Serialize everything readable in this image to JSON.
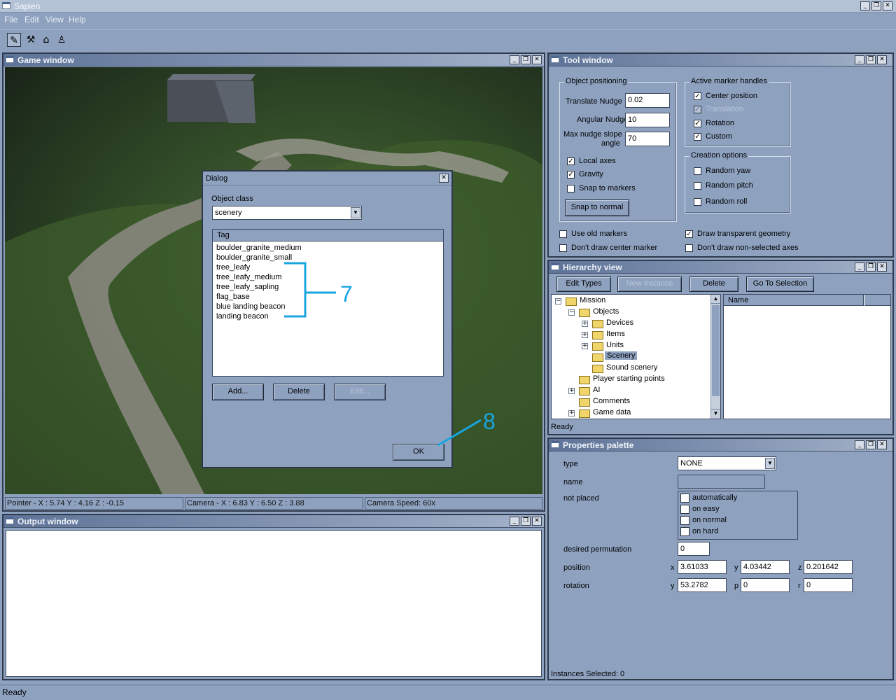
{
  "app": {
    "title": "Sapien"
  },
  "menu": [
    "File",
    "Edit",
    "View",
    "Help"
  ],
  "game_window": {
    "title": "Game window"
  },
  "status": {
    "pointer": "Pointer - X : 5.74  Y : 4.16  Z : -0.15",
    "camera": "Camera - X : 6.83  Y : 6.50  Z : 3.88",
    "speed": "Camera Speed: 60x"
  },
  "output_window": {
    "title": "Output window"
  },
  "bottom_status": "Ready",
  "dialog": {
    "title": "Dialog",
    "object_class_label": "Object class",
    "object_class_value": "scenery",
    "tag_header": "Tag",
    "tags": [
      "boulder_granite_medium",
      "boulder_granite_small",
      "tree_leafy",
      "tree_leafy_medium",
      "tree_leafy_sapling",
      "flag_base",
      "blue landing beacon",
      "landing beacon"
    ],
    "add": "Add...",
    "delete": "Delete",
    "edit": "Edit...",
    "ok": "OK"
  },
  "annotations": {
    "seven": "7",
    "eight": "8"
  },
  "tool_window": {
    "title": "Tool window",
    "object_positioning": "Object positioning",
    "translate_nudge_label": "Translate Nudge",
    "translate_nudge": "0.02",
    "angular_nudge_label": "Angular Nudge",
    "angular_nudge": "10",
    "max_slope_label_1": "Max nudge slope",
    "max_slope_label_2": "angle",
    "max_slope": "70",
    "local_axes": "Local axes",
    "gravity": "Gravity",
    "snap_markers": "Snap to markers",
    "snap_normal": "Snap to normal",
    "active_marker_handles": "Active marker handles",
    "center_position": "Center position",
    "translation": "Translation",
    "rotation": "Rotation",
    "custom": "Custom",
    "creation_options": "Creation options",
    "random_yaw": "Random yaw",
    "random_pitch": "Random pitch",
    "random_roll": "Random roll",
    "use_old_markers": "Use old markers",
    "dont_draw_center": "Don't draw center marker",
    "draw_transparent": "Draw transparent geometry",
    "dont_draw_nonselected": "Don't draw non-selected axes"
  },
  "hierarchy": {
    "title": "Hierarchy view",
    "edit_types": "Edit Types",
    "new_instance": "New Instance",
    "delete": "Delete",
    "go_to_selection": "Go To Selection",
    "tree": {
      "mission": "Mission",
      "objects": "Objects",
      "devices": "Devices",
      "items": "Items",
      "units": "Units",
      "scenery": "Scenery",
      "sound_scenery": "Sound scenery",
      "player_start": "Player starting points",
      "ai": "AI",
      "comments": "Comments",
      "game_data": "Game data"
    },
    "name_header": "Name",
    "status": "Ready"
  },
  "properties": {
    "title": "Properties palette",
    "type_label": "type",
    "type_value": "NONE",
    "name_label": "name",
    "not_placed_label": "not placed",
    "automatically": "automatically",
    "on_easy": "on easy",
    "on_normal": "on normal",
    "on_hard": "on hard",
    "desired_perm_label": "desired permutation",
    "desired_perm": "0",
    "position_label": "position",
    "x_lbl": "x",
    "pos_x": "3.61033",
    "y_lbl": "y",
    "pos_y": "4.03442",
    "z_lbl": "z",
    "pos_z": "0.201642",
    "rotation_label": "rotation",
    "ry_lbl": "y",
    "rot_y": "53.2782",
    "p_lbl": "p",
    "rot_p": "0",
    "r_lbl": "r",
    "rot_r": "0",
    "instances": "Instances Selected: 0"
  },
  "icons": [
    "window-icon",
    "pencil-icon",
    "marker-icon",
    "camera-icon",
    "figure-icon",
    "folder-icon",
    "minimize-icon",
    "restore-icon",
    "close-icon",
    "dropdown-arrow-icon"
  ],
  "colors": {
    "chrome": "#8ea2c0",
    "accent": "#17a6e0",
    "terrain": "#35502a"
  }
}
